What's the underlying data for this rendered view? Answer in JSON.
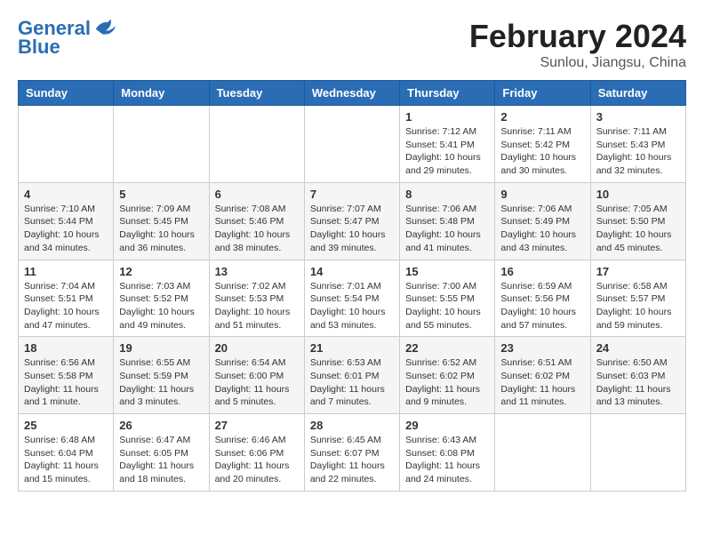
{
  "header": {
    "logo_line1": "General",
    "logo_line2": "Blue",
    "month": "February 2024",
    "location": "Sunlou, Jiangsu, China"
  },
  "weekdays": [
    "Sunday",
    "Monday",
    "Tuesday",
    "Wednesday",
    "Thursday",
    "Friday",
    "Saturday"
  ],
  "weeks": [
    [
      {
        "day": "",
        "info": ""
      },
      {
        "day": "",
        "info": ""
      },
      {
        "day": "",
        "info": ""
      },
      {
        "day": "",
        "info": ""
      },
      {
        "day": "1",
        "info": "Sunrise: 7:12 AM\nSunset: 5:41 PM\nDaylight: 10 hours\nand 29 minutes."
      },
      {
        "day": "2",
        "info": "Sunrise: 7:11 AM\nSunset: 5:42 PM\nDaylight: 10 hours\nand 30 minutes."
      },
      {
        "day": "3",
        "info": "Sunrise: 7:11 AM\nSunset: 5:43 PM\nDaylight: 10 hours\nand 32 minutes."
      }
    ],
    [
      {
        "day": "4",
        "info": "Sunrise: 7:10 AM\nSunset: 5:44 PM\nDaylight: 10 hours\nand 34 minutes."
      },
      {
        "day": "5",
        "info": "Sunrise: 7:09 AM\nSunset: 5:45 PM\nDaylight: 10 hours\nand 36 minutes."
      },
      {
        "day": "6",
        "info": "Sunrise: 7:08 AM\nSunset: 5:46 PM\nDaylight: 10 hours\nand 38 minutes."
      },
      {
        "day": "7",
        "info": "Sunrise: 7:07 AM\nSunset: 5:47 PM\nDaylight: 10 hours\nand 39 minutes."
      },
      {
        "day": "8",
        "info": "Sunrise: 7:06 AM\nSunset: 5:48 PM\nDaylight: 10 hours\nand 41 minutes."
      },
      {
        "day": "9",
        "info": "Sunrise: 7:06 AM\nSunset: 5:49 PM\nDaylight: 10 hours\nand 43 minutes."
      },
      {
        "day": "10",
        "info": "Sunrise: 7:05 AM\nSunset: 5:50 PM\nDaylight: 10 hours\nand 45 minutes."
      }
    ],
    [
      {
        "day": "11",
        "info": "Sunrise: 7:04 AM\nSunset: 5:51 PM\nDaylight: 10 hours\nand 47 minutes."
      },
      {
        "day": "12",
        "info": "Sunrise: 7:03 AM\nSunset: 5:52 PM\nDaylight: 10 hours\nand 49 minutes."
      },
      {
        "day": "13",
        "info": "Sunrise: 7:02 AM\nSunset: 5:53 PM\nDaylight: 10 hours\nand 51 minutes."
      },
      {
        "day": "14",
        "info": "Sunrise: 7:01 AM\nSunset: 5:54 PM\nDaylight: 10 hours\nand 53 minutes."
      },
      {
        "day": "15",
        "info": "Sunrise: 7:00 AM\nSunset: 5:55 PM\nDaylight: 10 hours\nand 55 minutes."
      },
      {
        "day": "16",
        "info": "Sunrise: 6:59 AM\nSunset: 5:56 PM\nDaylight: 10 hours\nand 57 minutes."
      },
      {
        "day": "17",
        "info": "Sunrise: 6:58 AM\nSunset: 5:57 PM\nDaylight: 10 hours\nand 59 minutes."
      }
    ],
    [
      {
        "day": "18",
        "info": "Sunrise: 6:56 AM\nSunset: 5:58 PM\nDaylight: 11 hours\nand 1 minute."
      },
      {
        "day": "19",
        "info": "Sunrise: 6:55 AM\nSunset: 5:59 PM\nDaylight: 11 hours\nand 3 minutes."
      },
      {
        "day": "20",
        "info": "Sunrise: 6:54 AM\nSunset: 6:00 PM\nDaylight: 11 hours\nand 5 minutes."
      },
      {
        "day": "21",
        "info": "Sunrise: 6:53 AM\nSunset: 6:01 PM\nDaylight: 11 hours\nand 7 minutes."
      },
      {
        "day": "22",
        "info": "Sunrise: 6:52 AM\nSunset: 6:02 PM\nDaylight: 11 hours\nand 9 minutes."
      },
      {
        "day": "23",
        "info": "Sunrise: 6:51 AM\nSunset: 6:02 PM\nDaylight: 11 hours\nand 11 minutes."
      },
      {
        "day": "24",
        "info": "Sunrise: 6:50 AM\nSunset: 6:03 PM\nDaylight: 11 hours\nand 13 minutes."
      }
    ],
    [
      {
        "day": "25",
        "info": "Sunrise: 6:48 AM\nSunset: 6:04 PM\nDaylight: 11 hours\nand 15 minutes."
      },
      {
        "day": "26",
        "info": "Sunrise: 6:47 AM\nSunset: 6:05 PM\nDaylight: 11 hours\nand 18 minutes."
      },
      {
        "day": "27",
        "info": "Sunrise: 6:46 AM\nSunset: 6:06 PM\nDaylight: 11 hours\nand 20 minutes."
      },
      {
        "day": "28",
        "info": "Sunrise: 6:45 AM\nSunset: 6:07 PM\nDaylight: 11 hours\nand 22 minutes."
      },
      {
        "day": "29",
        "info": "Sunrise: 6:43 AM\nSunset: 6:08 PM\nDaylight: 11 hours\nand 24 minutes."
      },
      {
        "day": "",
        "info": ""
      },
      {
        "day": "",
        "info": ""
      }
    ]
  ]
}
